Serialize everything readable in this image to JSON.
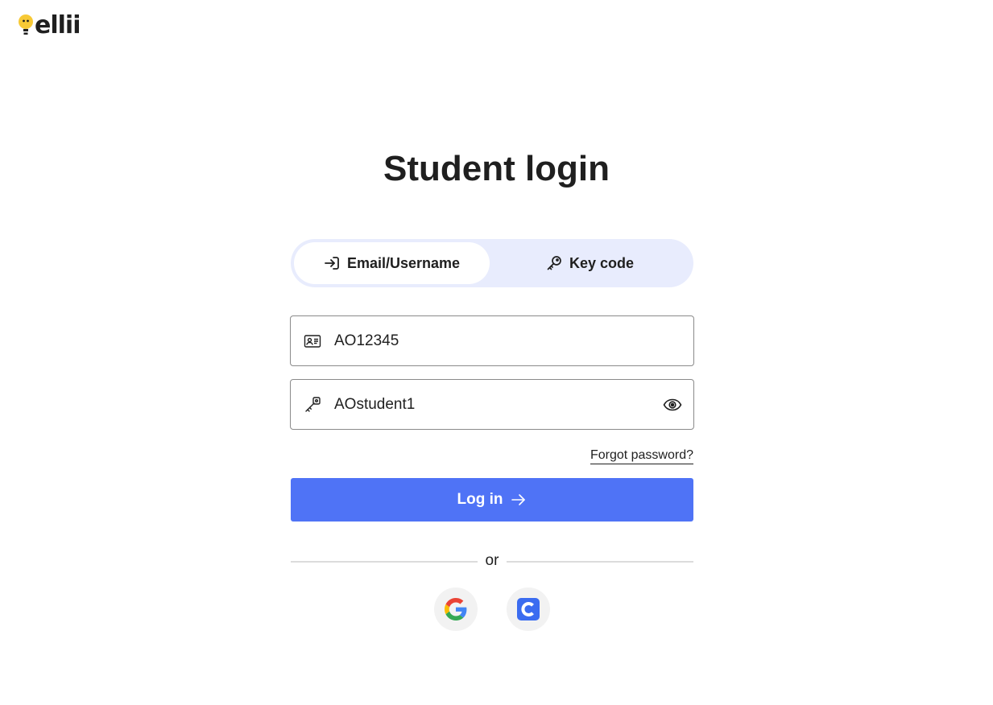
{
  "app": {
    "logo_text": "ellii"
  },
  "page": {
    "title": "Student login"
  },
  "tabs": [
    {
      "label": "Email/Username",
      "icon": "login-arrow-icon",
      "active": true
    },
    {
      "label": "Key code",
      "icon": "key-icon",
      "active": false
    }
  ],
  "form": {
    "username": {
      "value": "AO12345",
      "icon": "id-card-icon"
    },
    "password": {
      "value": "AOstudent1",
      "icon": "key-icon",
      "toggle_icon": "eye-icon"
    },
    "forgot_label": "Forgot password?",
    "login_label": "Log in",
    "login_icon": "arrow-right-icon"
  },
  "separator": {
    "label": "or"
  },
  "sso": [
    {
      "name": "google",
      "icon": "google-icon"
    },
    {
      "name": "clever",
      "icon": "clever-icon"
    }
  ],
  "colors": {
    "primary": "#4f73f6",
    "tab_background": "#e8ecfd",
    "logo_yellow": "#f7c935",
    "text": "#1f1f1f"
  }
}
